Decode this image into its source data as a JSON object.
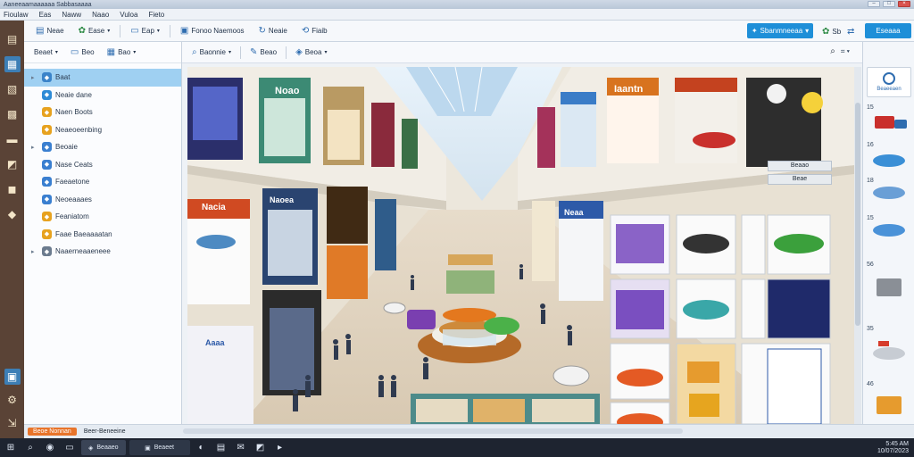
{
  "window": {
    "title": "Aaneeaamaaaaaa Sabbasaaaa",
    "controls": [
      "–",
      "□",
      "×"
    ]
  },
  "menu": [
    "Fioulaw",
    "Eas",
    "Naww",
    "Naao",
    "Vuloa",
    "Fieto"
  ],
  "toolbar": {
    "buttons": [
      {
        "label": "Neae",
        "icon": "document-icon"
      },
      {
        "label": "Ease",
        "icon": "leaf-icon"
      },
      {
        "label": "Eap",
        "icon": "window-icon"
      },
      {
        "label": "Fonoo Naemoos",
        "icon": "folder-icon"
      },
      {
        "label": "Neaie",
        "icon": "refresh-icon"
      },
      {
        "label": "Fiaib",
        "icon": "sync-icon"
      }
    ],
    "primary_label": "Sbanmneeaa",
    "extra_label": "Sb",
    "right_button_label": "Eseaaa"
  },
  "sidebar": {
    "tools": [
      "Beaet",
      "Beo",
      "Bao"
    ],
    "tree": [
      {
        "label": "Baat",
        "icon_color": "#3a83c9",
        "selected": true
      },
      {
        "label": "Neaie dane",
        "icon_color": "#2e8bd6",
        "selected": false
      },
      {
        "label": "Naen Boots",
        "icon_color": "#e7a21f",
        "selected": false
      },
      {
        "label": "Neaeoeenbing",
        "icon_color": "#e7a21f",
        "selected": false
      },
      {
        "label": "Beoaie",
        "icon_color": "#3a7fd0",
        "selected": false
      },
      {
        "label": "Nase Ceats",
        "icon_color": "#3a7fd0",
        "selected": false
      },
      {
        "label": "Faeaetone",
        "icon_color": "#3a7fd0",
        "selected": false
      },
      {
        "label": "Neoeaaaes",
        "icon_color": "#3a7fd0",
        "selected": false
      },
      {
        "label": "Feaniatom",
        "icon_color": "#e7a21f",
        "selected": false
      },
      {
        "label": "Faae Baeaaaatan",
        "icon_color": "#e7a21f",
        "selected": false
      },
      {
        "label": "Naaerneaaeneee",
        "icon_color": "#6b7b8e",
        "selected": false
      }
    ]
  },
  "main_tools": [
    "Baonnie",
    "Beao",
    "Beoa"
  ],
  "overlay_labels": [
    "Beaao",
    "Beae"
  ],
  "store_signs": [
    "Nacia",
    "Noao",
    "Iaantn",
    "Naoea",
    "Neaa",
    "Aaaa"
  ],
  "right_panel": {
    "top_label": "Beaeeaen",
    "counts": [
      "15",
      "16",
      "18",
      "15",
      "56",
      "35",
      "46"
    ]
  },
  "status": {
    "badge": "Beoe Nonnan",
    "text": "Beer-Beneeine"
  },
  "taskbar": {
    "apps": [
      "Beaaeo",
      "Beaeet"
    ],
    "time": "5:45 AM",
    "date": "10/07/2023"
  },
  "colors": {
    "accent": "#1e8fd8",
    "sidebar_dark": "#5a4336",
    "status_badge": "#e8742a"
  }
}
